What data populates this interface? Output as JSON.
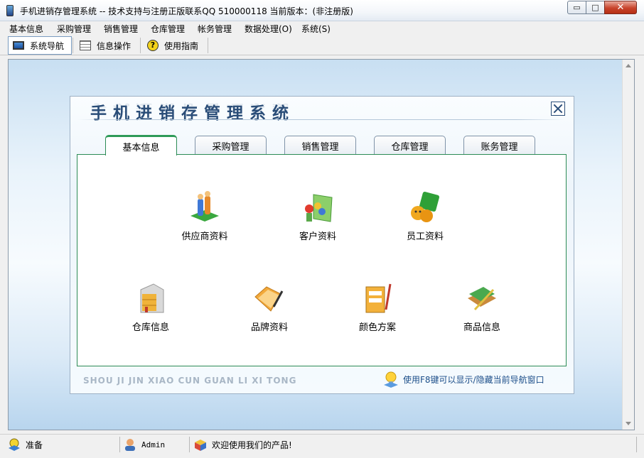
{
  "window": {
    "title": "手机进销存管理系统 -- 技术支持与注册正版联系QQ 510000118    当前版本：(非注册版)",
    "controls": {
      "minimize": "▭",
      "maximize": "□",
      "close": "✕"
    }
  },
  "menu": [
    "基本信息",
    "采购管理",
    "销售管理",
    "仓库管理",
    "帐务管理",
    "数据处理(O)",
    "系统(S)"
  ],
  "toolbar": {
    "nav_label": "系统导航",
    "info_label": "信息操作",
    "guide_label": "使用指南"
  },
  "panel": {
    "title": "手机进销存管理系统",
    "tabs": [
      "基本信息",
      "采购管理",
      "销售管理",
      "仓库管理",
      "账务管理"
    ],
    "active_tab": "基本信息",
    "items": [
      "供应商资料",
      "客户资料",
      "员工资料",
      "仓库信息",
      "品牌资料",
      "颜色方案",
      "商品信息"
    ],
    "footer_pinyin": "SHOU JI JIN XIAO CUN GUAN LI XI TONG",
    "footer_tip": "使用F8键可以显示/隐藏当前导航窗口"
  },
  "status": {
    "ready": "准备",
    "user": "Admin",
    "welcome": "欢迎使用我们的产品!"
  },
  "colors": {
    "accent_green": "#2e9b58",
    "title_blue": "#2a4d78",
    "tip_blue": "#1d4f8a"
  }
}
